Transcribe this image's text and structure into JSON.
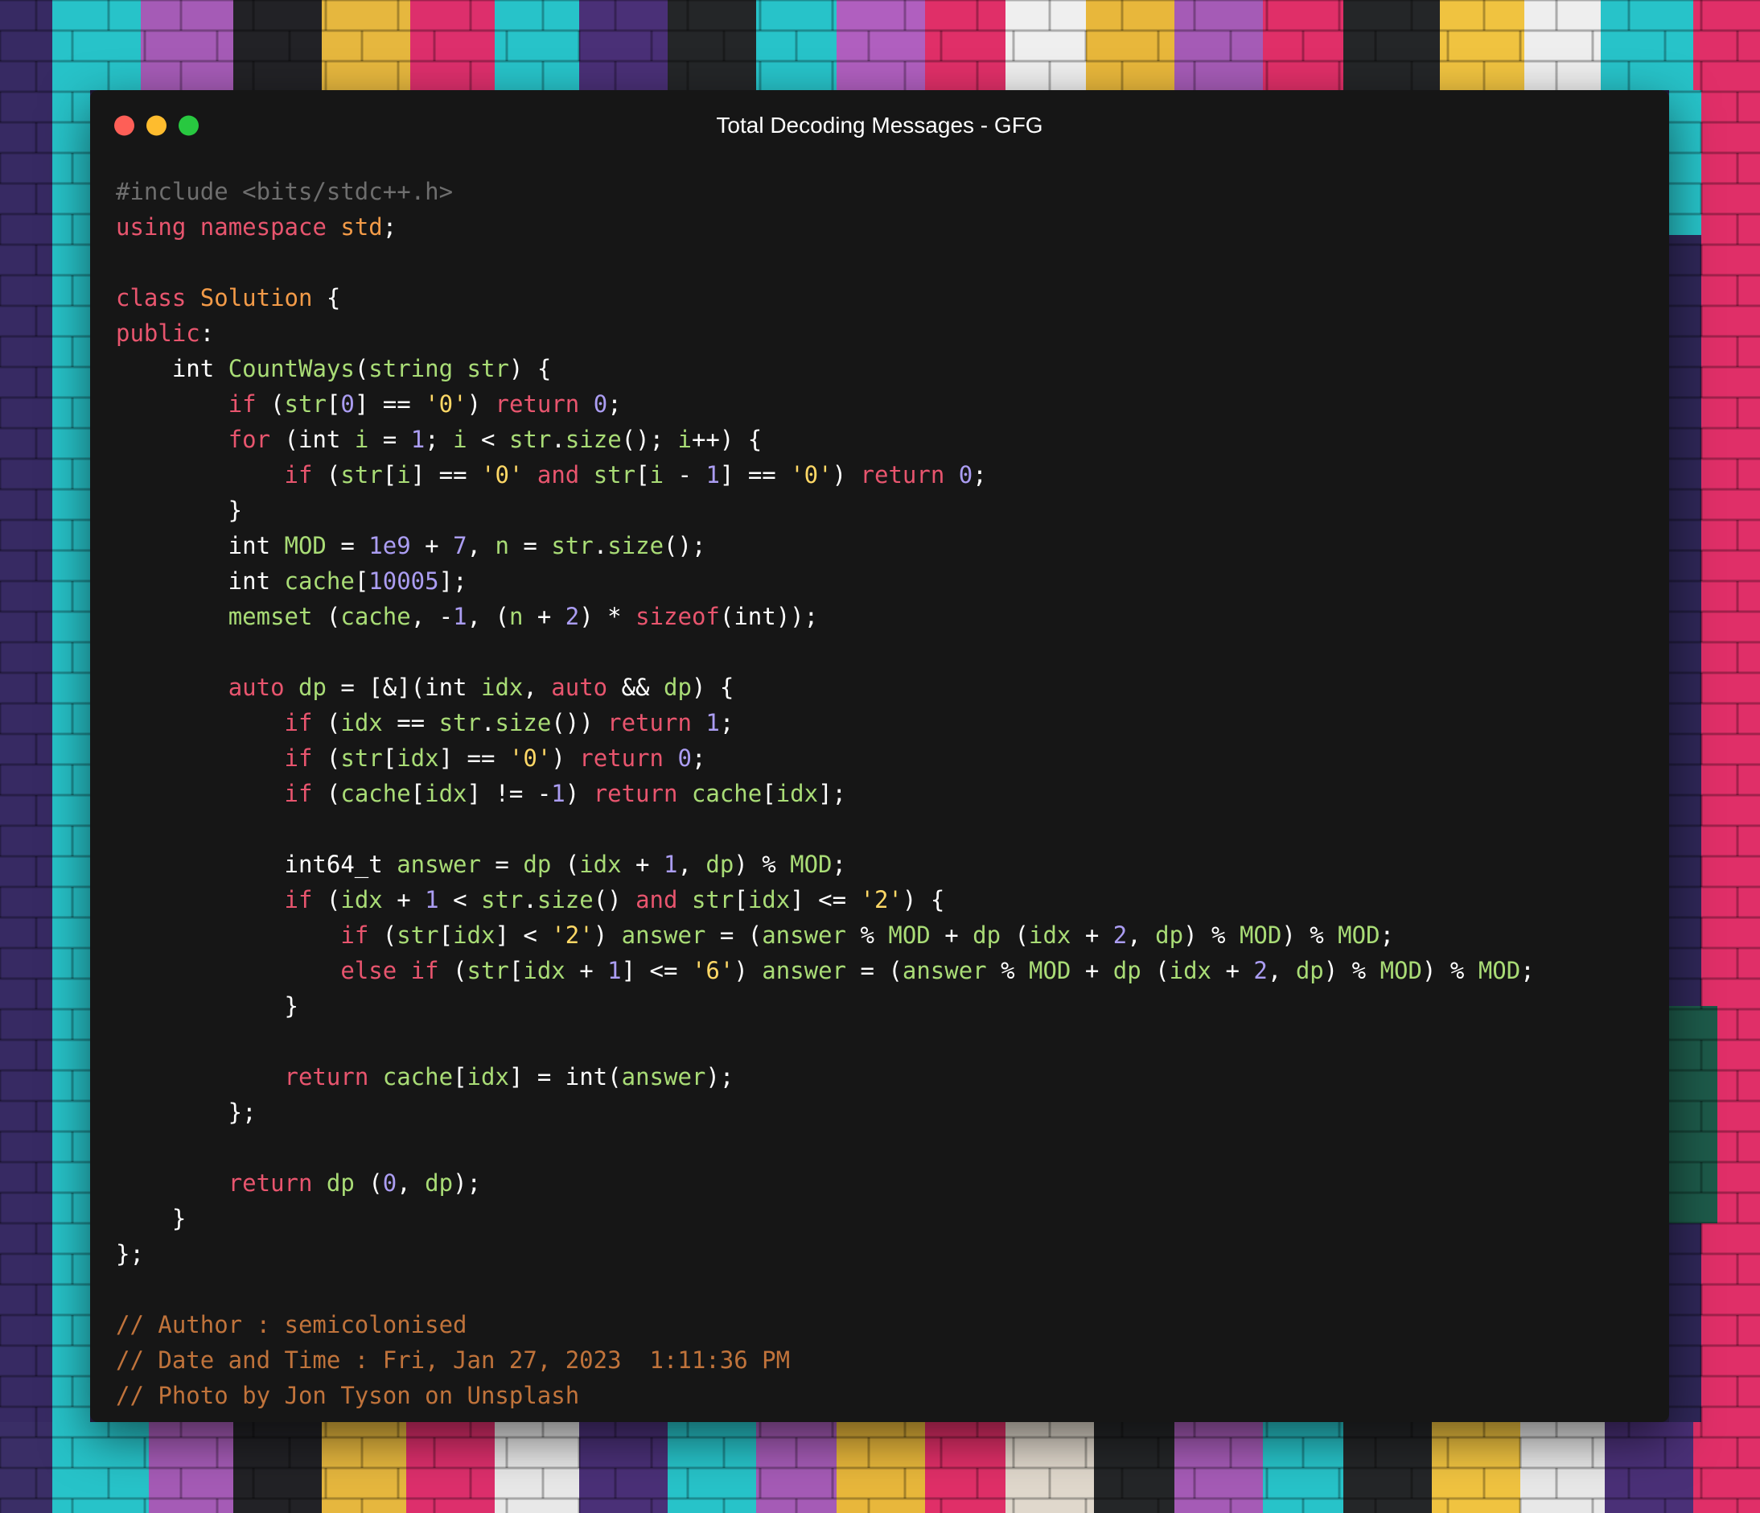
{
  "window": {
    "title": "Total Decoding Messages - GFG",
    "controls": [
      "close",
      "minimize",
      "maximize"
    ]
  },
  "colors": {
    "background": "#161616",
    "default": "#ffffff",
    "keyword": "#e8556e",
    "type": "#f39b48",
    "function": "#a9dc76",
    "number": "#ab9df2",
    "string": "#ffd866",
    "comment": "#c0733b",
    "preproc": "#6e6e6e"
  },
  "code": {
    "lines": [
      [
        {
          "t": "#include <bits/stdc++.h>",
          "c": "preproc"
        }
      ],
      [
        {
          "t": "using",
          "c": "keyword"
        },
        {
          "t": " "
        },
        {
          "t": "namespace",
          "c": "keyword"
        },
        {
          "t": " "
        },
        {
          "t": "std",
          "c": "type"
        },
        {
          "t": ";"
        }
      ],
      [],
      [
        {
          "t": "class",
          "c": "keyword"
        },
        {
          "t": " "
        },
        {
          "t": "Solution",
          "c": "type"
        },
        {
          "t": " {"
        }
      ],
      [
        {
          "t": "public",
          "c": "keyword"
        },
        {
          "t": ":"
        }
      ],
      [
        {
          "t": "    int "
        },
        {
          "t": "CountWays",
          "c": "function"
        },
        {
          "t": "("
        },
        {
          "t": "string",
          "c": "function"
        },
        {
          "t": " "
        },
        {
          "t": "str",
          "c": "function"
        },
        {
          "t": ") {"
        }
      ],
      [
        {
          "t": "        "
        },
        {
          "t": "if",
          "c": "keyword"
        },
        {
          "t": " ("
        },
        {
          "t": "str",
          "c": "function"
        },
        {
          "t": "["
        },
        {
          "t": "0",
          "c": "number"
        },
        {
          "t": "] == "
        },
        {
          "t": "'0'",
          "c": "string"
        },
        {
          "t": ") "
        },
        {
          "t": "return",
          "c": "keyword"
        },
        {
          "t": " "
        },
        {
          "t": "0",
          "c": "number"
        },
        {
          "t": ";"
        }
      ],
      [
        {
          "t": "        "
        },
        {
          "t": "for",
          "c": "keyword"
        },
        {
          "t": " (int "
        },
        {
          "t": "i",
          "c": "function"
        },
        {
          "t": " = "
        },
        {
          "t": "1",
          "c": "number"
        },
        {
          "t": "; "
        },
        {
          "t": "i",
          "c": "function"
        },
        {
          "t": " < "
        },
        {
          "t": "str",
          "c": "function"
        },
        {
          "t": "."
        },
        {
          "t": "size",
          "c": "function"
        },
        {
          "t": "(); "
        },
        {
          "t": "i",
          "c": "function"
        },
        {
          "t": "++) {"
        }
      ],
      [
        {
          "t": "            "
        },
        {
          "t": "if",
          "c": "keyword"
        },
        {
          "t": " ("
        },
        {
          "t": "str",
          "c": "function"
        },
        {
          "t": "["
        },
        {
          "t": "i",
          "c": "function"
        },
        {
          "t": "] == "
        },
        {
          "t": "'0'",
          "c": "string"
        },
        {
          "t": " "
        },
        {
          "t": "and",
          "c": "keyword"
        },
        {
          "t": " "
        },
        {
          "t": "str",
          "c": "function"
        },
        {
          "t": "["
        },
        {
          "t": "i",
          "c": "function"
        },
        {
          "t": " - "
        },
        {
          "t": "1",
          "c": "number"
        },
        {
          "t": "] == "
        },
        {
          "t": "'0'",
          "c": "string"
        },
        {
          "t": ") "
        },
        {
          "t": "return",
          "c": "keyword"
        },
        {
          "t": " "
        },
        {
          "t": "0",
          "c": "number"
        },
        {
          "t": ";"
        }
      ],
      [
        {
          "t": "        }"
        }
      ],
      [
        {
          "t": "        int "
        },
        {
          "t": "MOD",
          "c": "function"
        },
        {
          "t": " = "
        },
        {
          "t": "1e9",
          "c": "number"
        },
        {
          "t": " + "
        },
        {
          "t": "7",
          "c": "number"
        },
        {
          "t": ", "
        },
        {
          "t": "n",
          "c": "function"
        },
        {
          "t": " = "
        },
        {
          "t": "str",
          "c": "function"
        },
        {
          "t": "."
        },
        {
          "t": "size",
          "c": "function"
        },
        {
          "t": "();"
        }
      ],
      [
        {
          "t": "        int "
        },
        {
          "t": "cache",
          "c": "function"
        },
        {
          "t": "["
        },
        {
          "t": "10005",
          "c": "number"
        },
        {
          "t": "];"
        }
      ],
      [
        {
          "t": "        "
        },
        {
          "t": "memset",
          "c": "function"
        },
        {
          "t": " ("
        },
        {
          "t": "cache",
          "c": "function"
        },
        {
          "t": ", -"
        },
        {
          "t": "1",
          "c": "number"
        },
        {
          "t": ", ("
        },
        {
          "t": "n",
          "c": "function"
        },
        {
          "t": " + "
        },
        {
          "t": "2",
          "c": "number"
        },
        {
          "t": ") * "
        },
        {
          "t": "sizeof",
          "c": "keyword"
        },
        {
          "t": "(int));"
        }
      ],
      [],
      [
        {
          "t": "        "
        },
        {
          "t": "auto",
          "c": "keyword"
        },
        {
          "t": " "
        },
        {
          "t": "dp",
          "c": "function"
        },
        {
          "t": " = [&](int "
        },
        {
          "t": "idx",
          "c": "function"
        },
        {
          "t": ", "
        },
        {
          "t": "auto",
          "c": "keyword"
        },
        {
          "t": " && "
        },
        {
          "t": "dp",
          "c": "function"
        },
        {
          "t": ") {"
        }
      ],
      [
        {
          "t": "            "
        },
        {
          "t": "if",
          "c": "keyword"
        },
        {
          "t": " ("
        },
        {
          "t": "idx",
          "c": "function"
        },
        {
          "t": " == "
        },
        {
          "t": "str",
          "c": "function"
        },
        {
          "t": "."
        },
        {
          "t": "size",
          "c": "function"
        },
        {
          "t": "()) "
        },
        {
          "t": "return",
          "c": "keyword"
        },
        {
          "t": " "
        },
        {
          "t": "1",
          "c": "number"
        },
        {
          "t": ";"
        }
      ],
      [
        {
          "t": "            "
        },
        {
          "t": "if",
          "c": "keyword"
        },
        {
          "t": " ("
        },
        {
          "t": "str",
          "c": "function"
        },
        {
          "t": "["
        },
        {
          "t": "idx",
          "c": "function"
        },
        {
          "t": "] == "
        },
        {
          "t": "'0'",
          "c": "string"
        },
        {
          "t": ") "
        },
        {
          "t": "return",
          "c": "keyword"
        },
        {
          "t": " "
        },
        {
          "t": "0",
          "c": "number"
        },
        {
          "t": ";"
        }
      ],
      [
        {
          "t": "            "
        },
        {
          "t": "if",
          "c": "keyword"
        },
        {
          "t": " ("
        },
        {
          "t": "cache",
          "c": "function"
        },
        {
          "t": "["
        },
        {
          "t": "idx",
          "c": "function"
        },
        {
          "t": "] != -"
        },
        {
          "t": "1",
          "c": "number"
        },
        {
          "t": ") "
        },
        {
          "t": "return",
          "c": "keyword"
        },
        {
          "t": " "
        },
        {
          "t": "cache",
          "c": "function"
        },
        {
          "t": "["
        },
        {
          "t": "idx",
          "c": "function"
        },
        {
          "t": "];"
        }
      ],
      [],
      [
        {
          "t": "            int64_t "
        },
        {
          "t": "answer",
          "c": "function"
        },
        {
          "t": " = "
        },
        {
          "t": "dp",
          "c": "function"
        },
        {
          "t": " ("
        },
        {
          "t": "idx",
          "c": "function"
        },
        {
          "t": " + "
        },
        {
          "t": "1",
          "c": "number"
        },
        {
          "t": ", "
        },
        {
          "t": "dp",
          "c": "function"
        },
        {
          "t": ") % "
        },
        {
          "t": "MOD",
          "c": "function"
        },
        {
          "t": ";"
        }
      ],
      [
        {
          "t": "            "
        },
        {
          "t": "if",
          "c": "keyword"
        },
        {
          "t": " ("
        },
        {
          "t": "idx",
          "c": "function"
        },
        {
          "t": " + "
        },
        {
          "t": "1",
          "c": "number"
        },
        {
          "t": " < "
        },
        {
          "t": "str",
          "c": "function"
        },
        {
          "t": "."
        },
        {
          "t": "size",
          "c": "function"
        },
        {
          "t": "() "
        },
        {
          "t": "and",
          "c": "keyword"
        },
        {
          "t": " "
        },
        {
          "t": "str",
          "c": "function"
        },
        {
          "t": "["
        },
        {
          "t": "idx",
          "c": "function"
        },
        {
          "t": "] <= "
        },
        {
          "t": "'2'",
          "c": "string"
        },
        {
          "t": ") {"
        }
      ],
      [
        {
          "t": "                "
        },
        {
          "t": "if",
          "c": "keyword"
        },
        {
          "t": " ("
        },
        {
          "t": "str",
          "c": "function"
        },
        {
          "t": "["
        },
        {
          "t": "idx",
          "c": "function"
        },
        {
          "t": "] < "
        },
        {
          "t": "'2'",
          "c": "string"
        },
        {
          "t": ") "
        },
        {
          "t": "answer",
          "c": "function"
        },
        {
          "t": " = ("
        },
        {
          "t": "answer",
          "c": "function"
        },
        {
          "t": " % "
        },
        {
          "t": "MOD",
          "c": "function"
        },
        {
          "t": " + "
        },
        {
          "t": "dp",
          "c": "function"
        },
        {
          "t": " ("
        },
        {
          "t": "idx",
          "c": "function"
        },
        {
          "t": " + "
        },
        {
          "t": "2",
          "c": "number"
        },
        {
          "t": ", "
        },
        {
          "t": "dp",
          "c": "function"
        },
        {
          "t": ") % "
        },
        {
          "t": "MOD",
          "c": "function"
        },
        {
          "t": ") % "
        },
        {
          "t": "MOD",
          "c": "function"
        },
        {
          "t": ";"
        }
      ],
      [
        {
          "t": "                "
        },
        {
          "t": "else",
          "c": "keyword"
        },
        {
          "t": " "
        },
        {
          "t": "if",
          "c": "keyword"
        },
        {
          "t": " ("
        },
        {
          "t": "str",
          "c": "function"
        },
        {
          "t": "["
        },
        {
          "t": "idx",
          "c": "function"
        },
        {
          "t": " + "
        },
        {
          "t": "1",
          "c": "number"
        },
        {
          "t": "] <= "
        },
        {
          "t": "'6'",
          "c": "string"
        },
        {
          "t": ") "
        },
        {
          "t": "answer",
          "c": "function"
        },
        {
          "t": " = ("
        },
        {
          "t": "answer",
          "c": "function"
        },
        {
          "t": " % "
        },
        {
          "t": "MOD",
          "c": "function"
        },
        {
          "t": " + "
        },
        {
          "t": "dp",
          "c": "function"
        },
        {
          "t": " ("
        },
        {
          "t": "idx",
          "c": "function"
        },
        {
          "t": " + "
        },
        {
          "t": "2",
          "c": "number"
        },
        {
          "t": ", "
        },
        {
          "t": "dp",
          "c": "function"
        },
        {
          "t": ") % "
        },
        {
          "t": "MOD",
          "c": "function"
        },
        {
          "t": ") % "
        },
        {
          "t": "MOD",
          "c": "function"
        },
        {
          "t": ";"
        }
      ],
      [
        {
          "t": "            }"
        }
      ],
      [],
      [
        {
          "t": "            "
        },
        {
          "t": "return",
          "c": "keyword"
        },
        {
          "t": " "
        },
        {
          "t": "cache",
          "c": "function"
        },
        {
          "t": "["
        },
        {
          "t": "idx",
          "c": "function"
        },
        {
          "t": "] = int("
        },
        {
          "t": "answer",
          "c": "function"
        },
        {
          "t": ");"
        }
      ],
      [
        {
          "t": "        };"
        }
      ],
      [],
      [
        {
          "t": "        "
        },
        {
          "t": "return",
          "c": "keyword"
        },
        {
          "t": " "
        },
        {
          "t": "dp",
          "c": "function"
        },
        {
          "t": " ("
        },
        {
          "t": "0",
          "c": "number"
        },
        {
          "t": ", "
        },
        {
          "t": "dp",
          "c": "function"
        },
        {
          "t": ");"
        }
      ],
      [
        {
          "t": "    }"
        }
      ],
      [
        {
          "t": "};"
        }
      ],
      [],
      [
        {
          "t": "// Author : semicolonised",
          "c": "comment"
        }
      ],
      [
        {
          "t": "// Date and Time : Fri, Jan 27, 2023  1:11:36 PM",
          "c": "comment"
        }
      ],
      [
        {
          "t": "// Photo by Jon Tyson on Unsplash",
          "c": "comment"
        }
      ]
    ]
  }
}
